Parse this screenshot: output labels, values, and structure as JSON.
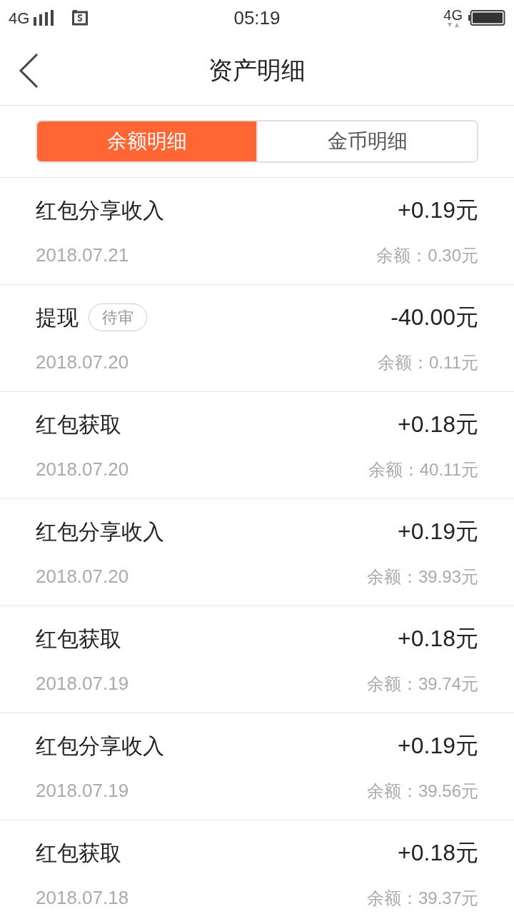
{
  "status_bar": {
    "network": "4G",
    "time": "05:19",
    "network_right": "4G"
  },
  "nav": {
    "title": "资产明细"
  },
  "tabs": [
    {
      "label": "余额明细",
      "selected": true
    },
    {
      "label": "金币明细",
      "selected": false
    }
  ],
  "records": [
    {
      "title": "红包分享收入",
      "amount": "+0.19元",
      "date": "2018.07.21",
      "balance": "余额：0.30元"
    },
    {
      "title": "提现",
      "badge": "待审",
      "amount": "-40.00元",
      "date": "2018.07.20",
      "balance": "余额：0.11元"
    },
    {
      "title": "红包获取",
      "amount": "+0.18元",
      "date": "2018.07.20",
      "balance": "余额：40.11元"
    },
    {
      "title": "红包分享收入",
      "amount": "+0.19元",
      "date": "2018.07.20",
      "balance": "余额：39.93元"
    },
    {
      "title": "红包获取",
      "amount": "+0.18元",
      "date": "2018.07.19",
      "balance": "余额：39.74元"
    },
    {
      "title": "红包分享收入",
      "amount": "+0.19元",
      "date": "2018.07.19",
      "balance": "余额：39.56元"
    },
    {
      "title": "红包获取",
      "amount": "+0.18元",
      "date": "2018.07.18",
      "balance": "余额：39.37元"
    }
  ]
}
